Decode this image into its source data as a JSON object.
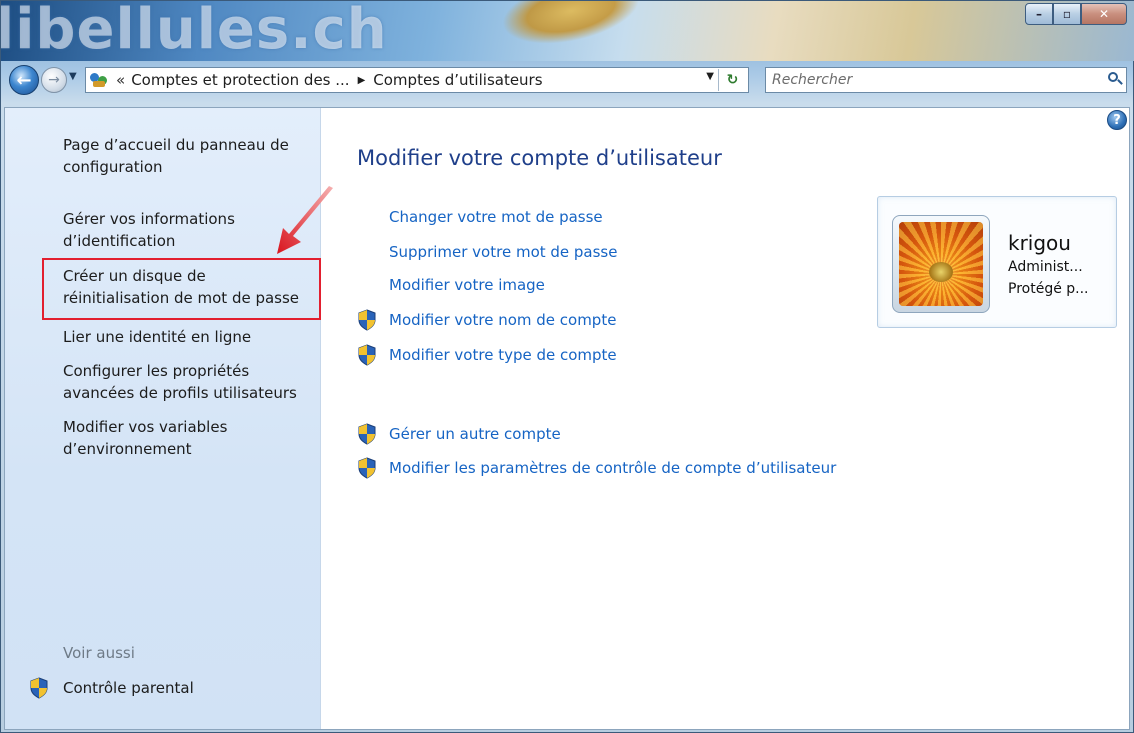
{
  "window": {
    "title_watermark": "libellules.ch"
  },
  "address_bar": {
    "overflow": "«",
    "crumb1": "Comptes et protection des ...",
    "crumb2": "Comptes d’utilisateurs",
    "search_placeholder": "Rechercher"
  },
  "sidebar": {
    "items": [
      {
        "label": "Page d’accueil du panneau de configuration"
      },
      {
        "label": "Gérer vos informations d’identification"
      },
      {
        "label": "Créer un disque de réinitialisation de mot de passe"
      },
      {
        "label": "Lier une identité en ligne"
      },
      {
        "label": "Configurer les propriétés avancées de profils utilisateurs"
      },
      {
        "label": "Modifier vos variables d’environnement"
      }
    ],
    "see_also": "Voir aussi",
    "parental": "Contrôle parental"
  },
  "main": {
    "title": "Modifier votre compte d’utilisateur",
    "tasks": [
      {
        "label": "Changer votre mot de passe",
        "shield": false
      },
      {
        "label": "Supprimer votre mot de passe",
        "shield": false
      },
      {
        "label": "Modifier votre image",
        "shield": false
      },
      {
        "label": "Modifier votre nom de compte",
        "shield": true
      },
      {
        "label": "Modifier votre type de compte",
        "shield": true
      }
    ],
    "tasks2": [
      {
        "label": "Gérer un autre compte",
        "shield": true
      },
      {
        "label": "Modifier les paramètres de contrôle de compte d’utilisateur",
        "shield": true
      }
    ]
  },
  "user": {
    "name": "krigou",
    "role": "Administ...",
    "status": "Protégé p..."
  },
  "colors": {
    "link": "#1664c4",
    "title": "#1f3f8a",
    "highlight_box": "#e21f2f"
  }
}
